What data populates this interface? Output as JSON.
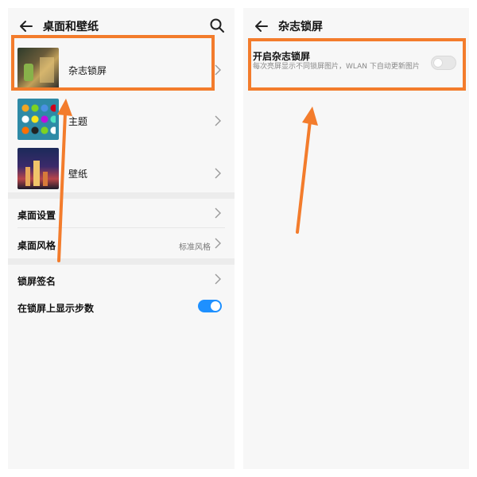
{
  "left_screen": {
    "header": {
      "title": "桌面和壁纸"
    },
    "items": [
      {
        "label": "杂志锁屏"
      },
      {
        "label": "主题"
      },
      {
        "label": "壁纸"
      }
    ],
    "settings": [
      {
        "label": "桌面设置"
      },
      {
        "label": "桌面风格",
        "value": "标准风格"
      },
      {
        "label": "锁屏签名"
      },
      {
        "label": "在锁屏上显示步数",
        "toggle": "on"
      }
    ]
  },
  "right_screen": {
    "header": {
      "title": "杂志锁屏"
    },
    "option": {
      "title": "开启杂志锁屏",
      "description": "每次亮屏显示不同锁屏图片，WLAN 下自动更新图片",
      "toggle": "off"
    }
  },
  "icons": [
    "back-arrow-icon",
    "search-icon",
    "chevron-right-icon",
    "annotation-arrow-icon"
  ],
  "colors": {
    "highlight": "#f37c2c",
    "toggle_on": "#1e90ff",
    "background": "#f7f7f7"
  }
}
